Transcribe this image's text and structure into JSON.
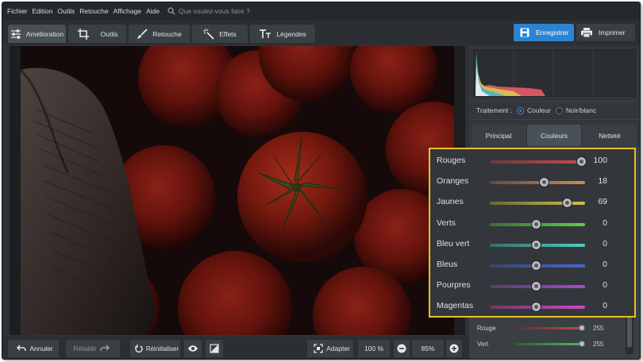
{
  "menu": {
    "items": [
      "Fichier",
      "Edition",
      "Outils",
      "Retouche",
      "Affichage",
      "Aide"
    ],
    "search_placeholder": "Que voulez-vous faire ?"
  },
  "toolbar": {
    "tabs": [
      {
        "label": "Amélioration",
        "icon": "sliders-icon"
      },
      {
        "label": "Outils",
        "icon": "crop-icon"
      },
      {
        "label": "Retouche",
        "icon": "brush-icon"
      },
      {
        "label": "Effets",
        "icon": "magic-wand-icon"
      },
      {
        "label": "Légendes",
        "icon": "text-icon"
      }
    ],
    "save_label": "Enregistrer",
    "print_label": "Imprimer"
  },
  "bottombar": {
    "undo_label": "Annuler",
    "redo_label": "Rétablir",
    "reset_label": "Réinitialiser",
    "fit_label": "Adapter",
    "zoom_100_label": "100 %",
    "zoom_value": "85%"
  },
  "panel": {
    "treatment_label": "Traitement :",
    "color_option": "Couleur",
    "bw_option": "Noir/blanc",
    "tabs": [
      "Principal",
      "Couleurs",
      "Netteté"
    ],
    "rgb": [
      {
        "label": "Rouge",
        "value": "255"
      },
      {
        "label": "Vert",
        "value": "255"
      }
    ]
  },
  "colors": [
    {
      "label": "Rouges",
      "value": "100",
      "level": 1.0,
      "gradient": [
        "#6b3a3a",
        "#d04848"
      ]
    },
    {
      "label": "Oranges",
      "value": "18",
      "level": 0.59,
      "gradient": [
        "#6b4a3a",
        "#d08a48"
      ]
    },
    {
      "label": "Jaunes",
      "value": "69",
      "level": 0.845,
      "gradient": [
        "#6b643a",
        "#d0c248"
      ]
    },
    {
      "label": "Verts",
      "value": "0",
      "level": 0.5,
      "gradient": [
        "#3f6b3a",
        "#5ad048"
      ]
    },
    {
      "label": "Bleu vert",
      "value": "0",
      "level": 0.5,
      "gradient": [
        "#3a6b66",
        "#48d0c4"
      ]
    },
    {
      "label": "Bleus",
      "value": "0",
      "level": 0.5,
      "gradient": [
        "#3a456b",
        "#4865d0"
      ]
    },
    {
      "label": "Pourpres",
      "value": "0",
      "level": 0.5,
      "gradient": [
        "#5a3a6b",
        "#a948d0"
      ]
    },
    {
      "label": "Magentas",
      "value": "0",
      "level": 0.5,
      "gradient": [
        "#6b3a64",
        "#d048c4"
      ]
    }
  ],
  "theme": {
    "accent": "#2b84d2",
    "highlight": "#e8c322"
  }
}
